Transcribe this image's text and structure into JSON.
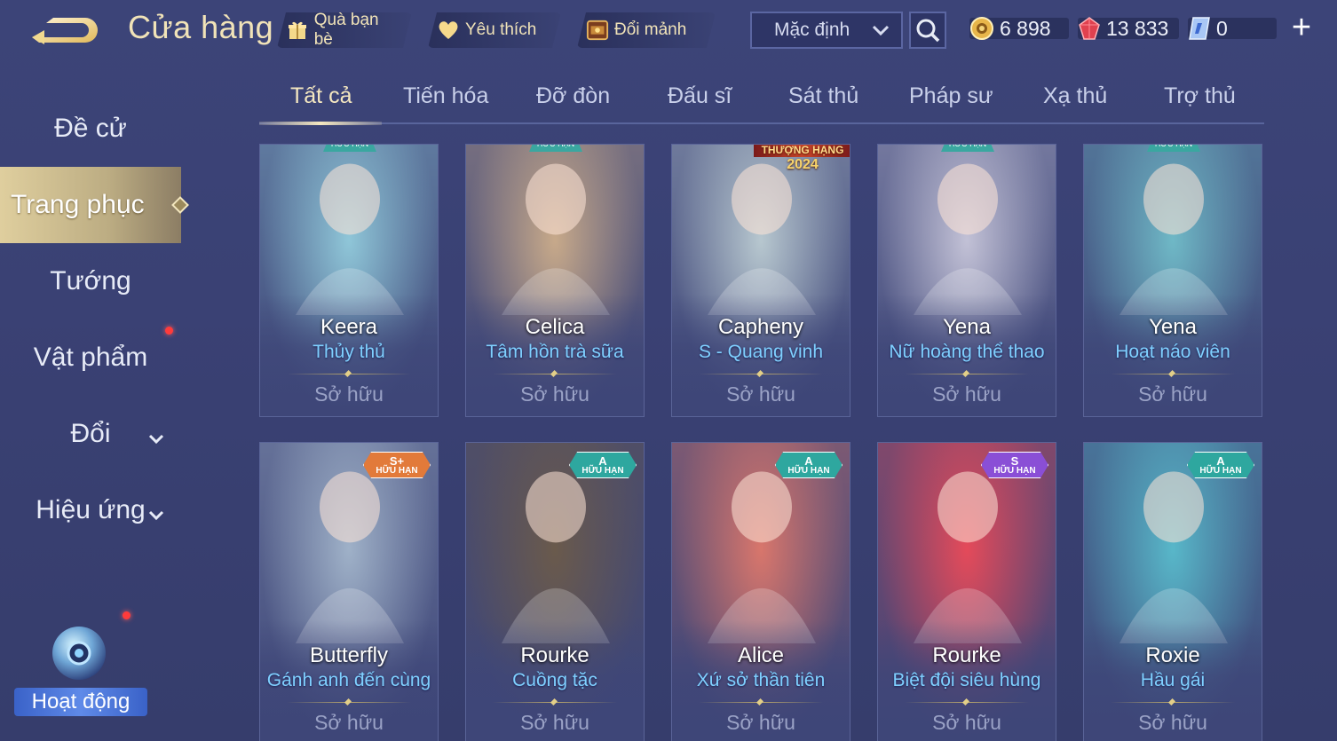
{
  "header": {
    "title": "Cửa hàng",
    "gift_label": "Quà bạn bè",
    "favorite_label": "Yêu thích",
    "shard_label": "Đổi mảnh",
    "sort": {
      "selected": "Mặc định"
    },
    "currencies": {
      "gold": "6 898",
      "ruby": "13 833",
      "ticket": "0"
    }
  },
  "sidebar": {
    "items": [
      {
        "label": "Đề cử"
      },
      {
        "label": "Trang phục"
      },
      {
        "label": "Tướng"
      },
      {
        "label": "Vật phẩm"
      },
      {
        "label": "Đổi"
      },
      {
        "label": "Hiệu ứng"
      }
    ],
    "activity_label": "Hoạt động"
  },
  "tabs": [
    {
      "label": "Tất cả"
    },
    {
      "label": "Tiến hóa"
    },
    {
      "label": "Đỡ đòn"
    },
    {
      "label": "Đấu sĩ"
    },
    {
      "label": "Sát thủ"
    },
    {
      "label": "Pháp sư"
    },
    {
      "label": "Xạ thủ"
    },
    {
      "label": "Trợ thủ"
    }
  ],
  "cards": [
    {
      "hero": "Keera",
      "skin": "Thủy thủ",
      "status": "Sở hữu",
      "badge_lim": "HỮU HẠN",
      "color": "#8fc6d8"
    },
    {
      "hero": "Celica",
      "skin": "Tâm hồn trà sữa",
      "status": "Sở hữu",
      "badge_lim": "HỮU HẠN",
      "color": "#c7a98a"
    },
    {
      "hero": "Capheny",
      "skin": "S - Quang vinh",
      "status": "Sở hữu",
      "ranked_l1": "THƯỢNG HẠNG",
      "ranked_l2": "2024",
      "color": "#b7c7cf"
    },
    {
      "hero": "Yena",
      "skin": "Nữ hoàng thể thao",
      "status": "Sở hữu",
      "badge_lim": "HỮU HẠN",
      "color": "#c2c1d6"
    },
    {
      "hero": "Yena",
      "skin": "Hoạt náo viên",
      "status": "Sở hữu",
      "badge_lim": "HỮU HẠN",
      "color": "#6fb8c6"
    },
    {
      "hero": "Butterfly",
      "skin": "Gánh anh đến cùng",
      "status": "Sở hữu",
      "badge_tier": "S+",
      "badge_lim": "HỮU HẠN",
      "color": "#9fb1c8"
    },
    {
      "hero": "Rourke",
      "skin": "Cuồng tặc",
      "status": "Sở hữu",
      "badge_tier": "A",
      "badge_lim": "HỮU HẠN",
      "color": "#6a5a4c"
    },
    {
      "hero": "Alice",
      "skin": "Xứ sở thần tiên",
      "status": "Sở hữu",
      "badge_tier": "A",
      "badge_lim": "HỮU HẠN",
      "color": "#d8766c"
    },
    {
      "hero": "Rourke",
      "skin": "Biệt đội siêu hùng",
      "status": "Sở hữu",
      "badge_tier": "S",
      "badge_lim": "HỮU HẠN",
      "color": "#e44a5a"
    },
    {
      "hero": "Roxie",
      "skin": "Hầu gái",
      "status": "Sở hữu",
      "badge_tier": "A",
      "badge_lim": "HỮU HẠN",
      "color": "#58b7c9"
    }
  ],
  "colors": {
    "accent_gold": "#f1e3b8",
    "skin_name": "#7fd0ff",
    "badge_teal": "#2ea79f",
    "badge_orange": "#e27a3a",
    "badge_purple": "#8a4fd6"
  }
}
